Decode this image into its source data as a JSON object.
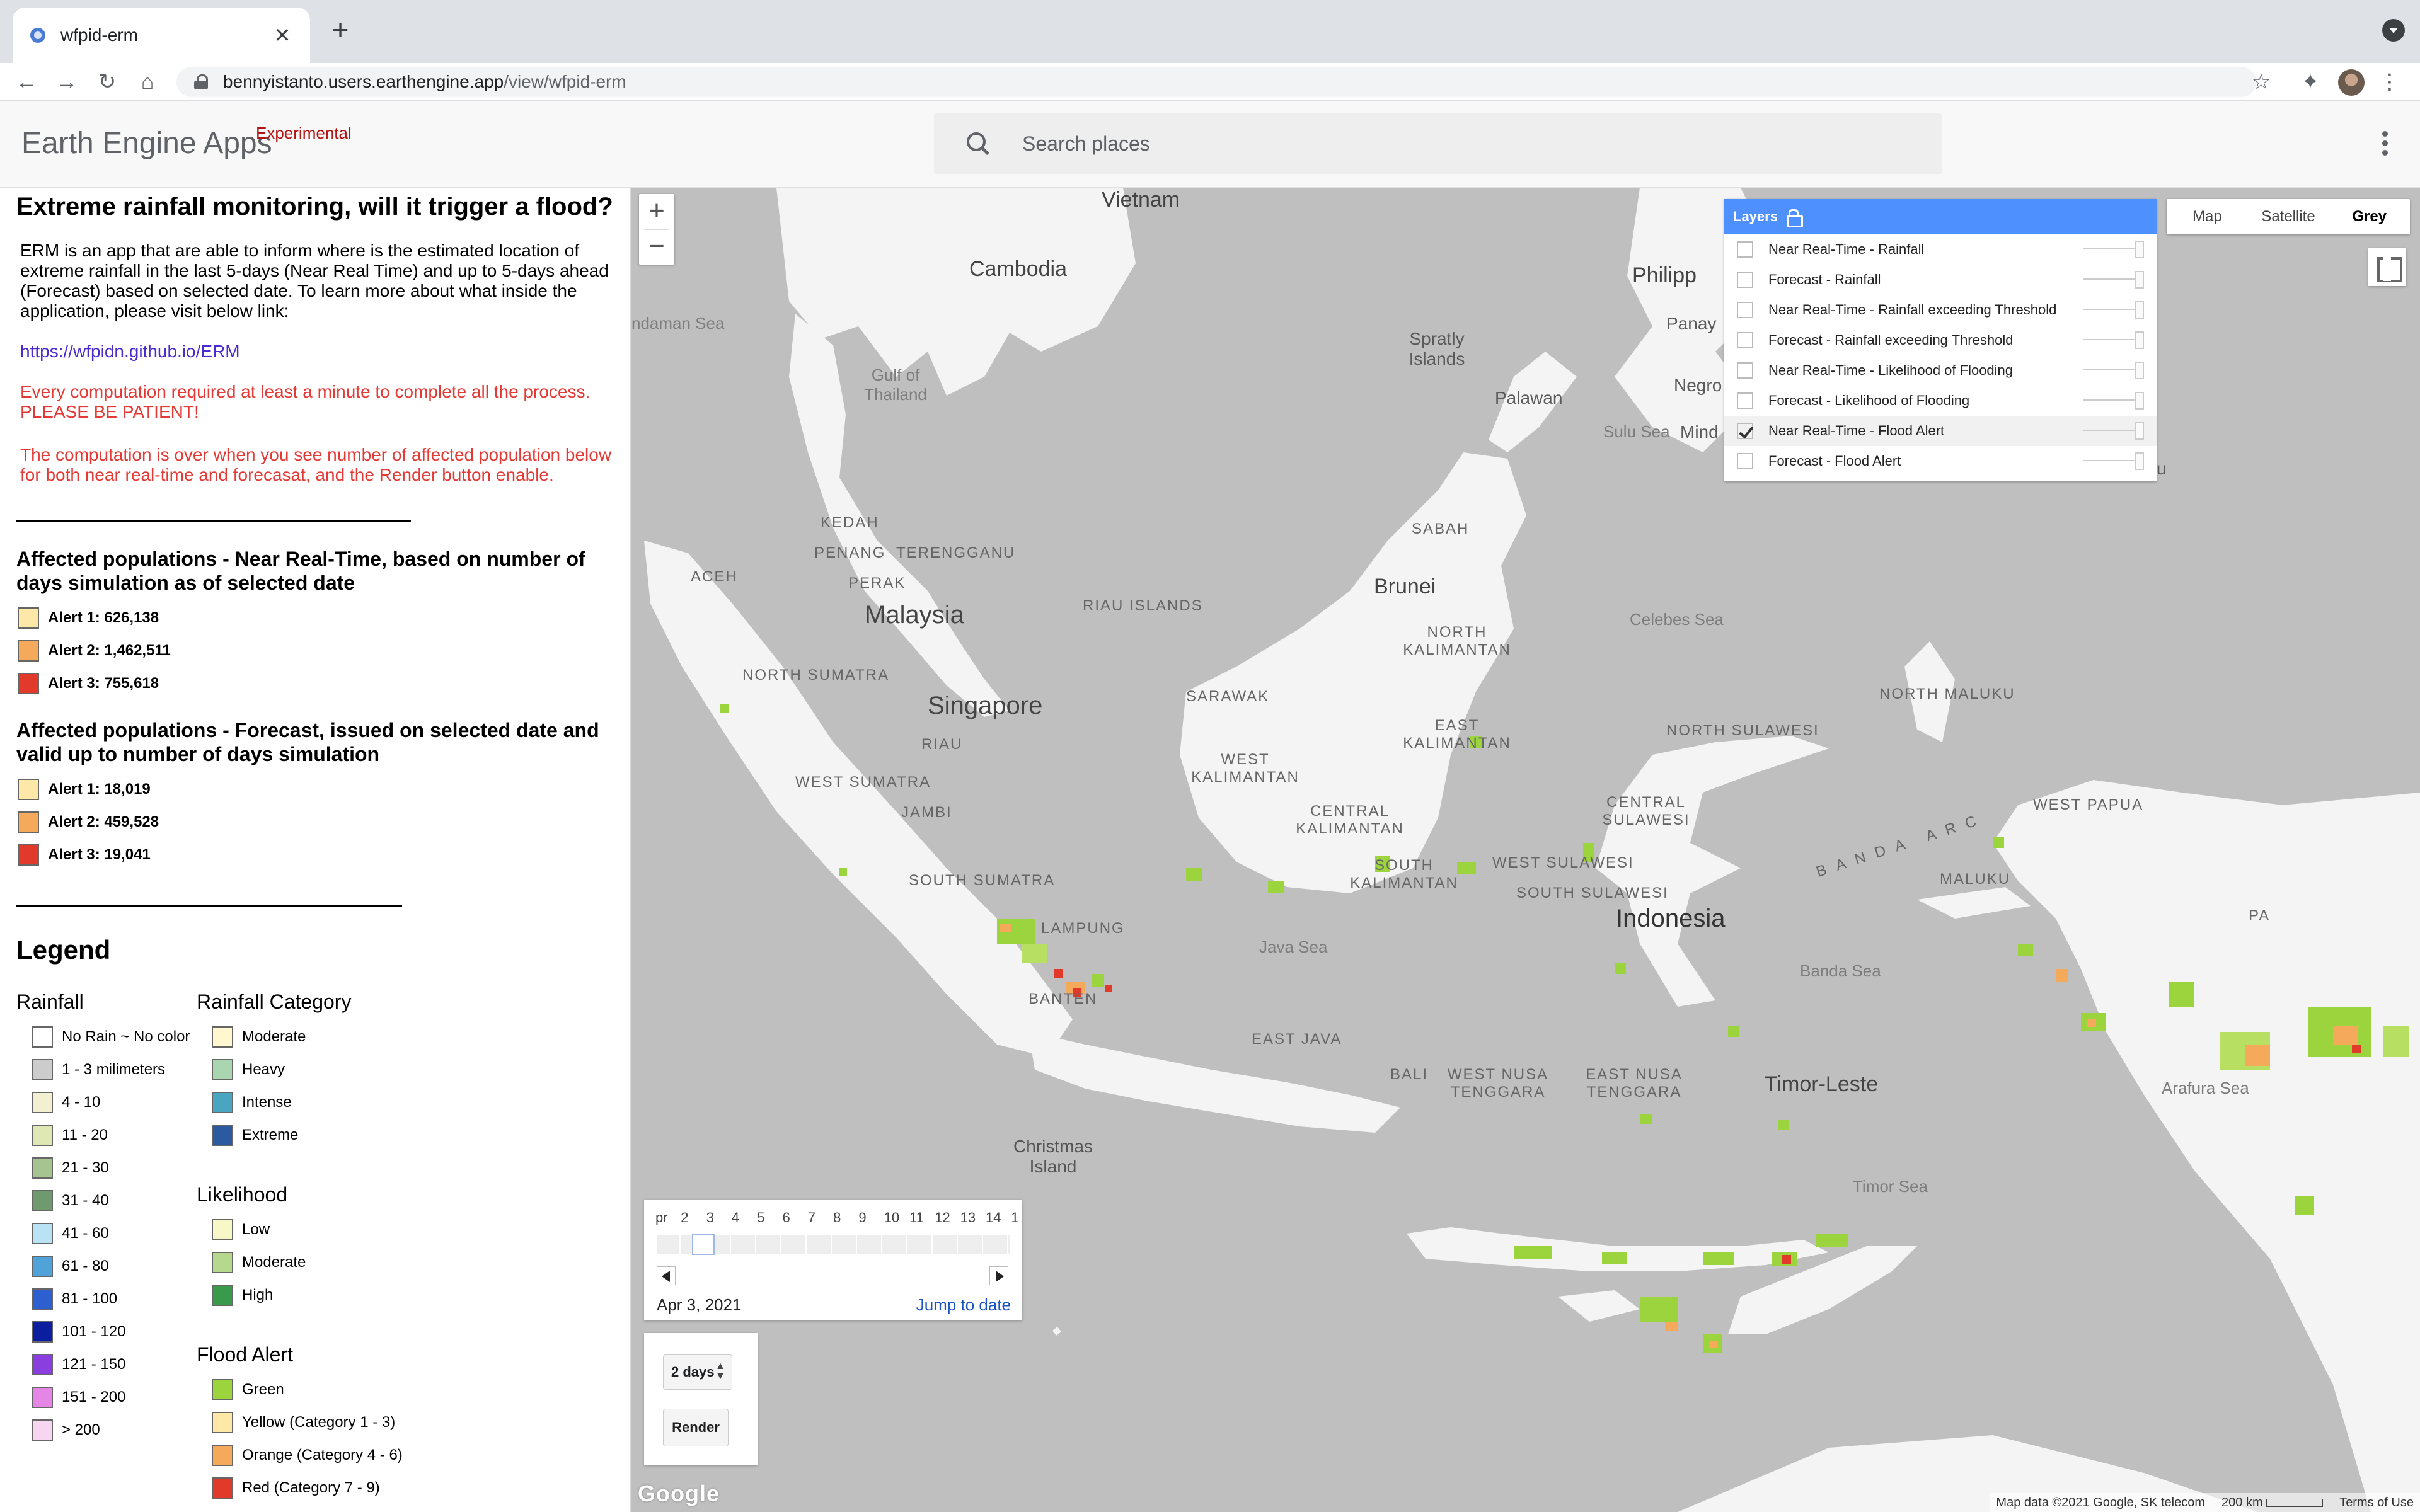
{
  "browser": {
    "tab_title": "wfpid-erm",
    "tab_close": "✕",
    "new_tab": "+",
    "url_host": "bennyistanto.users.earthengine.app",
    "url_path": "/view/wfpid-erm",
    "nav": {
      "back": "←",
      "forward": "→",
      "reload": "↻",
      "home": "⌂"
    },
    "star": "☆",
    "extensions": "✦",
    "menu": "⋮"
  },
  "app": {
    "name": "Earth Engine Apps",
    "badge": "Experimental",
    "search_placeholder": "Search places"
  },
  "panel": {
    "title": "Extreme rainfall monitoring, will it trigger a flood?",
    "intro": "ERM is an app that are able to inform where is the estimated location of extreme rainfall in the last 5-days (Near Real Time) and up to 5-days ahead (Forecast) based on selected date. To learn more about what inside the application, please visit below link:",
    "link": "https://wfpidn.github.io/ERM",
    "warning1": "Every computation required at least a minute to complete all the process. PLEASE BE PATIENT!",
    "warning2": "The computation is over when you see number of affected population below for both near real-time and forecasat, and the Render button enable.",
    "nrt_heading": "Affected populations - Near Real-Time, based on number of days simulation as of selected date",
    "nrt_alerts": [
      {
        "label": "Alert 1: 626,138",
        "color": "#fde8a8"
      },
      {
        "label": "Alert 2: 1,462,511",
        "color": "#f5a95a"
      },
      {
        "label": "Alert 3: 755,618",
        "color": "#e23a2a"
      }
    ],
    "fc_heading": "Affected populations - Forecast, issued on selected date and valid up to number of days simulation",
    "fc_alerts": [
      {
        "label": "Alert 1: 18,019",
        "color": "#fde8a8"
      },
      {
        "label": "Alert 2: 459,528",
        "color": "#f5a95a"
      },
      {
        "label": "Alert 3: 19,041",
        "color": "#e23a2a"
      }
    ]
  },
  "legend": {
    "title": "Legend",
    "rainfall": {
      "title": "Rainfall",
      "items": [
        {
          "label": "No Rain ~ No color",
          "color": "#ffffff"
        },
        {
          "label": "1 - 3 milimeters",
          "color": "#cccccc"
        },
        {
          "label": "4 - 10",
          "color": "#f3f0d2"
        },
        {
          "label": "11 - 20",
          "color": "#dfe8b4"
        },
        {
          "label": "21 - 30",
          "color": "#a5c48f"
        },
        {
          "label": "31 - 40",
          "color": "#6e9a6e"
        },
        {
          "label": "41 - 60",
          "color": "#b9e2f5"
        },
        {
          "label": "61 - 80",
          "color": "#4fa3d9"
        },
        {
          "label": "81 - 100",
          "color": "#2d5fd0"
        },
        {
          "label": "101 - 120",
          "color": "#0c1ea0"
        },
        {
          "label": "121 - 150",
          "color": "#8a3ee0"
        },
        {
          "label": "151 - 200",
          "color": "#e586e6"
        },
        {
          "label": "> 200",
          "color": "#f8d6ef"
        }
      ]
    },
    "category": {
      "title": "Rainfall Category",
      "items": [
        {
          "label": "Moderate",
          "color": "#fff7cf"
        },
        {
          "label": "Heavy",
          "color": "#a9d5b0"
        },
        {
          "label": "Intense",
          "color": "#4aa6c0"
        },
        {
          "label": "Extreme",
          "color": "#2b5aa0"
        }
      ]
    },
    "likelihood": {
      "title": "Likelihood",
      "items": [
        {
          "label": "Low",
          "color": "#f8f7c8"
        },
        {
          "label": "Moderate",
          "color": "#b5d88e"
        },
        {
          "label": "High",
          "color": "#3a9a4c"
        }
      ]
    },
    "flood_alert": {
      "title": "Flood Alert",
      "items": [
        {
          "label": "Green",
          "color": "#9bd43c"
        },
        {
          "label": "Yellow (Category 1 - 3)",
          "color": "#fde8a8"
        },
        {
          "label": "Orange (Category 4 - 6)",
          "color": "#f5a95a"
        },
        {
          "label": "Red (Category 7 - 9)",
          "color": "#e23a2a"
        }
      ]
    }
  },
  "map": {
    "zoom_in": "+",
    "zoom_out": "−",
    "map_types": [
      "Map",
      "Satellite",
      "Grey"
    ],
    "selected_map_type": "Grey",
    "layers_title": "Layers",
    "layers": [
      {
        "label": "Near Real-Time - Rainfall",
        "checked": false
      },
      {
        "label": "Forecast - Rainfall",
        "checked": false
      },
      {
        "label": "Near Real-Time - Rainfall exceeding Threshold",
        "checked": false
      },
      {
        "label": "Forecast - Rainfall exceeding Threshold",
        "checked": false
      },
      {
        "label": "Near Real-Time - Likelihood of Flooding",
        "checked": false
      },
      {
        "label": "Forecast - Likelihood of Flooding",
        "checked": false
      },
      {
        "label": "Near Real-Time - Flood Alert",
        "checked": true
      },
      {
        "label": "Forecast - Flood Alert",
        "checked": false
      }
    ],
    "labels": {
      "vietnam": "Vietnam",
      "cambodia": "Cambodia",
      "gulf": "Gulf of Thailand",
      "andaman": "ndaman Sea",
      "philippines": "Philipp",
      "panay": "Panay",
      "negros": "Negro",
      "spratly": "Spratly Islands",
      "palawan": "Palawan",
      "sulu": "Sulu Sea",
      "minda": "Mind",
      "kedah": "KEDAH",
      "penang": "PENANG",
      "terengganu": "TERENGGANU",
      "perak": "PERAK",
      "aceh": "ACEH",
      "malaysia": "Malaysia",
      "sabah": "SABAH",
      "brunei": "Brunei",
      "riau_islands": "RIAU ISLANDS",
      "north_kalimantan": "NORTH KALIMANTAN",
      "celebes": "Celebes Sea",
      "north_sumatra": "NORTH SUMATRA",
      "singapore": "Singapore",
      "sarawak": "SARAWAK",
      "riau": "RIAU",
      "east_kalimantan": "EAST KALIMANTAN",
      "north_maluku": "NORTH MALUKU",
      "west_kalimantan": "WEST KALIMANTAN",
      "north_sulawesi": "NORTH SULAWESI",
      "west_sumatra": "WEST SUMATRA",
      "jambi": "JAMBI",
      "central_kalimantan": "CENTRAL KALIMANTAN",
      "central_sulawesi": "CENTRAL SULAWESI",
      "west_papua": "WEST PAPUA",
      "banda_arc": "BANDA ARC",
      "south_kalimantan": "SOUTH KALIMANTAN",
      "west_sulawesi": "WEST SULAWESI",
      "south_sumatra": "SOUTH SUMATRA",
      "south_sulawesi": "SOUTH SULAWESI",
      "maluku": "MALUKU",
      "indonesia": "Indonesia",
      "lampung": "LAMPUNG",
      "java_sea": "Java Sea",
      "banda_sea": "Banda Sea",
      "banten": "BANTEN",
      "east_java": "EAST JAVA",
      "bali": "BALI",
      "wnt": "WEST NUSA TENGGARA",
      "ent": "EAST NUSA TENGGARA",
      "timor_leste": "Timor-Leste",
      "arafura": "Arafura Sea",
      "christmas": "Christmas Island",
      "timor_sea": "Timor Sea",
      "pa": "PA",
      "u": "u"
    },
    "date_slider": {
      "tick_labels": [
        "pr",
        "2",
        "3",
        "4",
        "5",
        "6",
        "7",
        "8",
        "9",
        "10",
        "11",
        "12",
        "13",
        "14",
        "1"
      ],
      "selected_date": "Apr 3, 2021",
      "jump_label": "Jump to date"
    },
    "days_select": "2 days",
    "render_label": "Render",
    "google_logo": "Google",
    "attribution": "Map data ©2021 Google, SK telecom",
    "scale": "200 km",
    "terms": "Terms of Use"
  }
}
